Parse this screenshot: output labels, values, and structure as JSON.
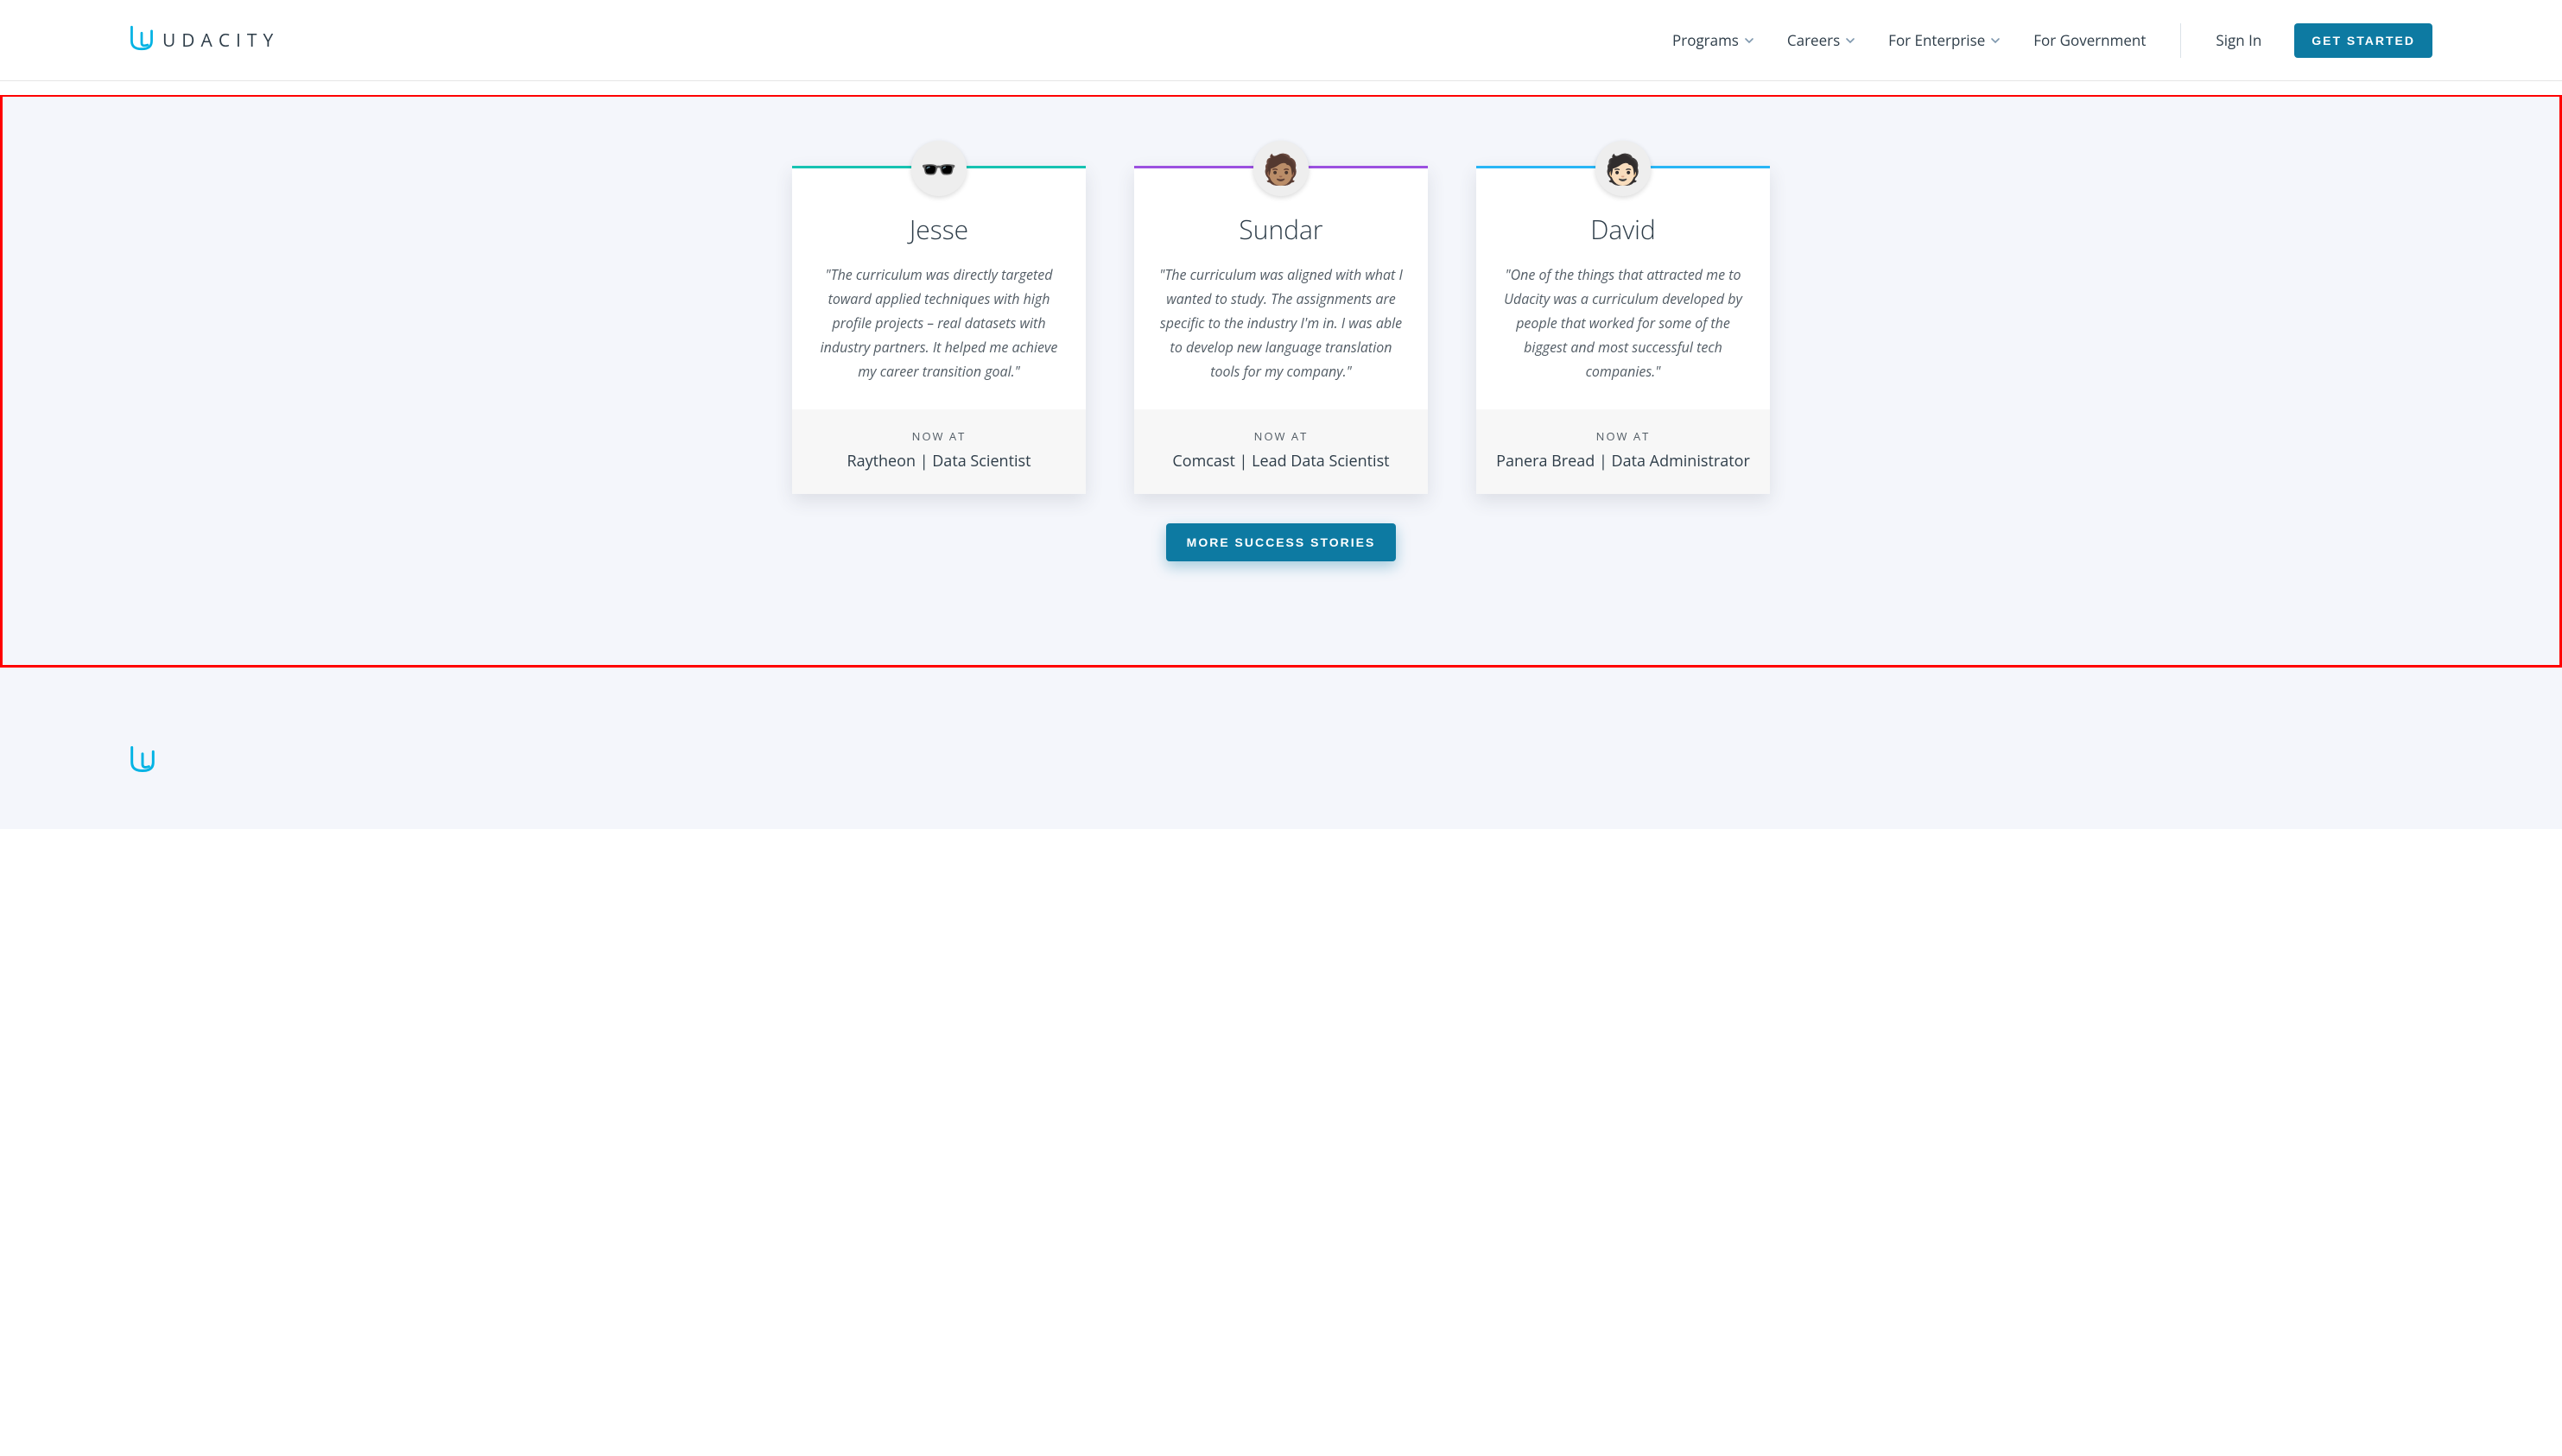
{
  "header": {
    "brand": "UDACITY",
    "nav": {
      "programs": "Programs",
      "careers": "Careers",
      "enterprise": "For Enterprise",
      "government": "For Government",
      "sign_in": "Sign In",
      "get_started": "GET STARTED"
    }
  },
  "testimonials": [
    {
      "name": "Jesse",
      "quote": "\"The curriculum was directly targeted toward applied techniques with high profile projects – real datasets with industry partners. It helped me achieve my career transition goal.\"",
      "now_at_label": "NOW AT",
      "job": "Raytheon | Data Scientist",
      "avatar_emoji": "🕶️"
    },
    {
      "name": "Sundar",
      "quote": "\"The curriculum was aligned with what I wanted to study. The assignments are specific to the industry I'm in. I was able to develop new language translation tools for my company.\"",
      "now_at_label": "NOW AT",
      "job": "Comcast | Lead Data Scientist",
      "avatar_emoji": "🧑🏽"
    },
    {
      "name": "David",
      "quote": "\"One of the things that attracted me to Udacity was a curriculum developed by people that worked for some of the biggest and most successful tech companies.\"",
      "now_at_label": "NOW AT",
      "job": "Panera Bread | Data Administrator",
      "avatar_emoji": "🧑🏻"
    }
  ],
  "more_button": "MORE SUCCESS STORIES"
}
